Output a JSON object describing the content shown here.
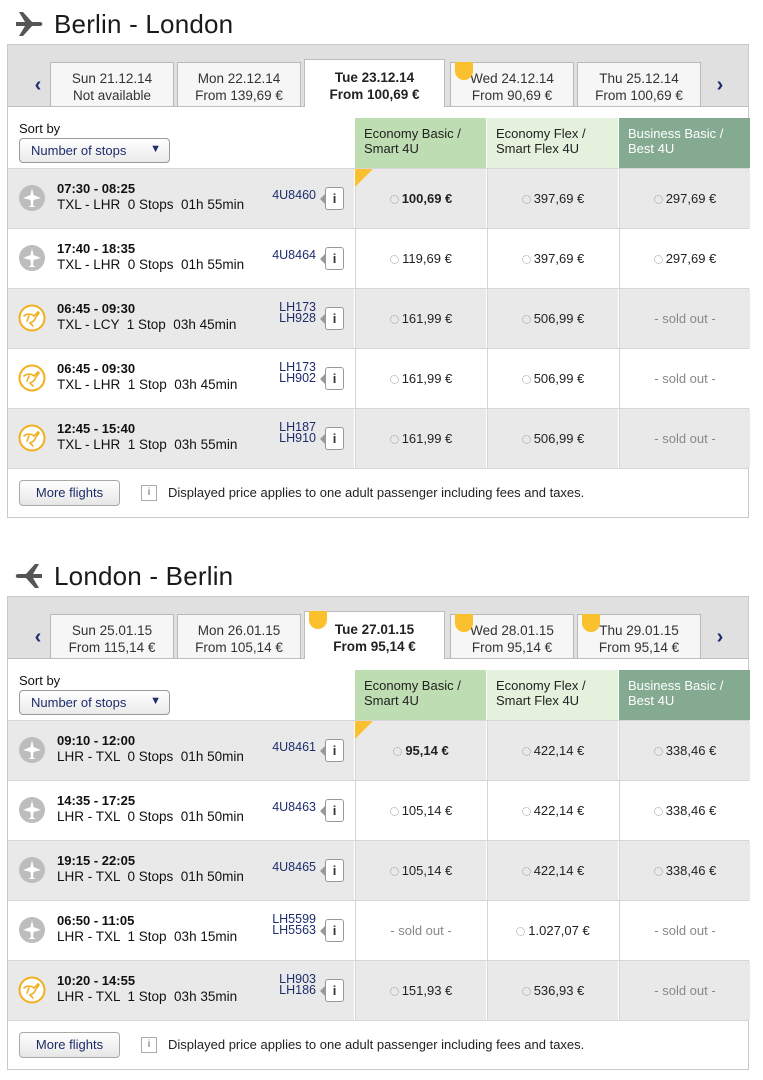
{
  "outbound": {
    "title": "Berlin - London",
    "tabs": [
      {
        "day": "Sun 21.12.14",
        "price": "Not available",
        "active": false,
        "marker": false
      },
      {
        "day": "Mon 22.12.14",
        "price": "From 139,69 €",
        "active": false,
        "marker": false
      },
      {
        "day": "Tue 23.12.14",
        "price": "From 100,69 €",
        "active": true,
        "marker": false
      },
      {
        "day": "Wed 24.12.14",
        "price": "From 90,69 €",
        "active": false,
        "marker": true
      },
      {
        "day": "Thu 25.12.14",
        "price": "From 100,69 €",
        "active": false,
        "marker": false
      }
    ],
    "sort_label": "Sort by",
    "sort_value": "Number of stops",
    "fare_headers": [
      "Economy Basic / Smart 4U",
      "Economy Flex / Smart Flex 4U",
      "Business Basic / Best 4U"
    ],
    "flights": [
      {
        "times": "07:30 - 08:25",
        "route": "TXL - LHR  0 Stops  01h 55min",
        "numbers": [
          "4U8460"
        ],
        "airline": "germanwings",
        "prices": [
          "100,69 €",
          "397,69 €",
          "297,69 €"
        ],
        "best": true
      },
      {
        "times": "17:40 - 18:35",
        "route": "TXL - LHR  0 Stops  01h 55min",
        "numbers": [
          "4U8464"
        ],
        "airline": "germanwings",
        "prices": [
          "119,69 €",
          "397,69 €",
          "297,69 €"
        ],
        "best": false
      },
      {
        "times": "06:45 - 09:30",
        "route": "TXL - LCY  1 Stop  03h 45min",
        "numbers": [
          "LH173",
          "LH928"
        ],
        "airline": "lufthansa",
        "prices": [
          "161,99 €",
          "506,99 €",
          "- sold out -"
        ],
        "best": false
      },
      {
        "times": "06:45 - 09:30",
        "route": "TXL - LHR  1 Stop  03h 45min",
        "numbers": [
          "LH173",
          "LH902"
        ],
        "airline": "lufthansa",
        "prices": [
          "161,99 €",
          "506,99 €",
          "- sold out -"
        ],
        "best": false
      },
      {
        "times": "12:45 - 15:40",
        "route": "TXL - LHR  1 Stop  03h 55min",
        "numbers": [
          "LH187",
          "LH910"
        ],
        "airline": "lufthansa",
        "prices": [
          "161,99 €",
          "506,99 €",
          "- sold out -"
        ],
        "best": false
      }
    ],
    "more_label": "More flights",
    "note": "Displayed price applies to one adult passenger including fees and taxes."
  },
  "return": {
    "title": "London - Berlin",
    "tabs": [
      {
        "day": "Sun 25.01.15",
        "price": "From 115,14 €",
        "active": false,
        "marker": false
      },
      {
        "day": "Mon 26.01.15",
        "price": "From 105,14 €",
        "active": false,
        "marker": false
      },
      {
        "day": "Tue 27.01.15",
        "price": "From 95,14 €",
        "active": true,
        "marker": true
      },
      {
        "day": "Wed 28.01.15",
        "price": "From 95,14 €",
        "active": false,
        "marker": true
      },
      {
        "day": "Thu 29.01.15",
        "price": "From 95,14 €",
        "active": false,
        "marker": true
      }
    ],
    "sort_label": "Sort by",
    "sort_value": "Number of stops",
    "fare_headers": [
      "Economy Basic / Smart 4U",
      "Economy Flex / Smart Flex 4U",
      "Business Basic / Best 4U"
    ],
    "flights": [
      {
        "times": "09:10 - 12:00",
        "route": "LHR - TXL  0 Stops  01h 50min",
        "numbers": [
          "4U8461"
        ],
        "airline": "germanwings",
        "prices": [
          "95,14 €",
          "422,14 €",
          "338,46 €"
        ],
        "best": true
      },
      {
        "times": "14:35 - 17:25",
        "route": "LHR - TXL  0 Stops  01h 50min",
        "numbers": [
          "4U8463"
        ],
        "airline": "germanwings",
        "prices": [
          "105,14 €",
          "422,14 €",
          "338,46 €"
        ],
        "best": false
      },
      {
        "times": "19:15 - 22:05",
        "route": "LHR - TXL  0 Stops  01h 50min",
        "numbers": [
          "4U8465"
        ],
        "airline": "germanwings",
        "prices": [
          "105,14 €",
          "422,14 €",
          "338,46 €"
        ],
        "best": false
      },
      {
        "times": "06:50 - 11:05",
        "route": "LHR - TXL  1 Stop  03h 15min",
        "numbers": [
          "LH5599",
          "LH5563"
        ],
        "airline": "germanwings",
        "prices": [
          "- sold out -",
          "1.027,07 €",
          "- sold out -"
        ],
        "best": false
      },
      {
        "times": "10:20 - 14:55",
        "route": "LHR - TXL  1 Stop  03h 35min",
        "numbers": [
          "LH903",
          "LH186"
        ],
        "airline": "lufthansa",
        "prices": [
          "151,93 €",
          "536,93 €",
          "- sold out -"
        ],
        "best": false
      }
    ],
    "more_label": "More flights",
    "note": "Displayed price applies to one adult passenger including fees and taxes."
  },
  "icons": {
    "outbound": "airplane-departure-icon",
    "return": "airplane-arrival-icon",
    "germanwings": "grey-plane-icon",
    "lufthansa": "lufthansa-crane-icon"
  },
  "colors": {
    "link_blue": "#1d2c6b",
    "highlight_yellow": "#fbc02d",
    "economy_basic": "#bfddb2",
    "economy_flex": "#e4f1dd",
    "business": "#85aa92"
  }
}
